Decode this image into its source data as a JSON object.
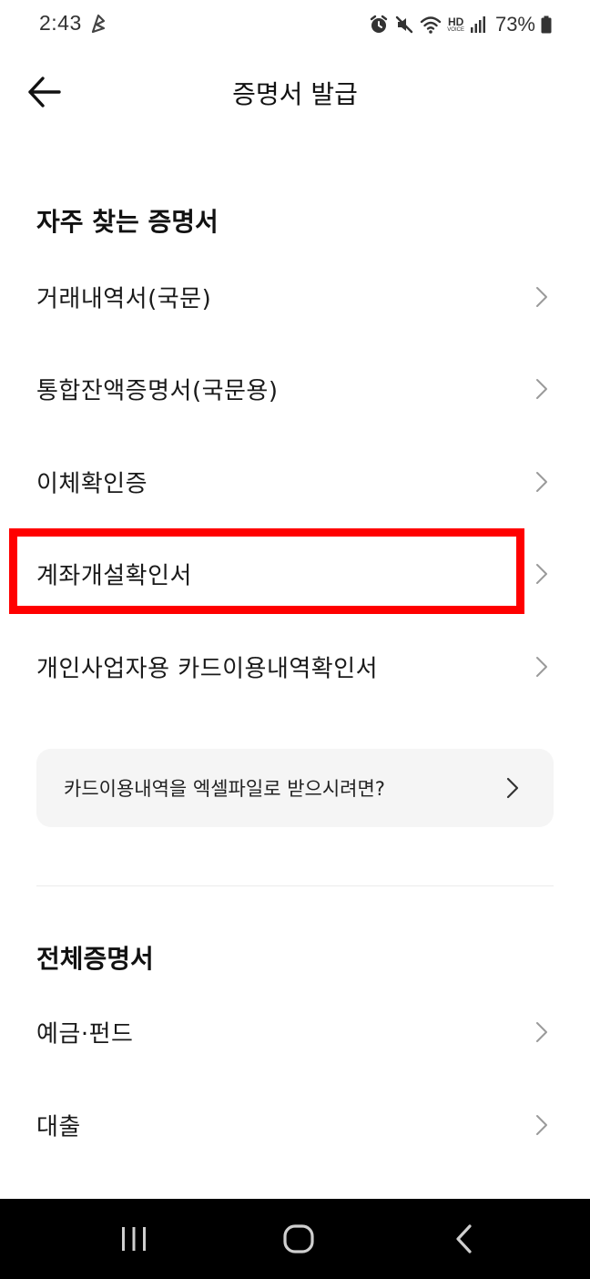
{
  "status_bar": {
    "time": "2:43",
    "battery": "73%",
    "hd_label": "HD",
    "voice_label": "VOICE",
    "icons": [
      "alarm-icon",
      "mute-icon",
      "wifi-icon",
      "hd-voice-icon",
      "signal-icon",
      "battery-icon"
    ]
  },
  "header": {
    "title": "증명서 발급",
    "back_icon": "arrow-left-icon"
  },
  "frequent": {
    "title": "자주 찾는 증명서",
    "items": [
      {
        "label": "거래내역서(국문)"
      },
      {
        "label": "통합잔액증명서(국문용)"
      },
      {
        "label": "이체확인증"
      },
      {
        "label": "계좌개설확인서",
        "highlighted": true
      },
      {
        "label": "개인사업자용 카드이용내역확인서"
      }
    ]
  },
  "info_card": {
    "label": "카드이용내역을 엑셀파일로 받으시려면?"
  },
  "all": {
    "title": "전체증명서",
    "items": [
      {
        "label": "예금·펀드"
      },
      {
        "label": "대출"
      }
    ]
  },
  "nav_bar": {
    "buttons": [
      "recent-apps-icon",
      "home-icon",
      "back-icon"
    ]
  },
  "colors": {
    "highlight": "#ff0000",
    "card_background": "#f5f5f5",
    "nav_background": "#000000"
  }
}
